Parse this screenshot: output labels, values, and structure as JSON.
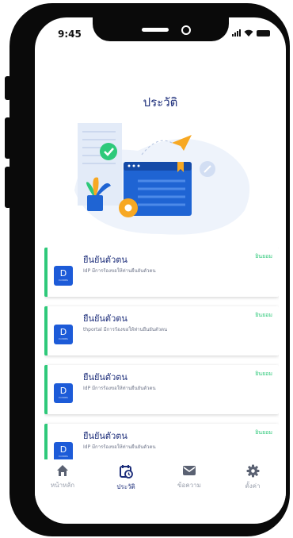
{
  "status_bar": {
    "time": "9:45"
  },
  "page": {
    "title": "ประวัติ"
  },
  "history": {
    "items": [
      {
        "title": "ยืนยันตัวตน",
        "description": "IdP มีการร้องขอให้ท่านยืนยันตัวตน",
        "status": "ยินยอม",
        "logo_letter": "D",
        "logo_sub": "D.DOPA"
      },
      {
        "title": "ยืนยันตัวตน",
        "description": "thportal มีการร้องขอให้ท่านยืนยันตัวตน",
        "status": "ยินยอม",
        "logo_letter": "D",
        "logo_sub": "D.DOPA"
      },
      {
        "title": "ยืนยันตัวตน",
        "description": "IdP มีการร้องขอให้ท่านยืนยันตัวตน",
        "status": "ยินยอม",
        "logo_letter": "D",
        "logo_sub": "D.DOPA"
      },
      {
        "title": "ยืนยันตัวตน",
        "description": "IdP มีการร้องขอให้ท่านยืนยันตัวตน",
        "status": "ยินยอม",
        "logo_letter": "D",
        "logo_sub": "D.DOPA"
      }
    ]
  },
  "tabbar": {
    "tabs": [
      {
        "label": "หน้าหลัก",
        "icon": "home-icon"
      },
      {
        "label": "ประวัติ",
        "icon": "history-icon",
        "active": true
      },
      {
        "label": "ข้อความ",
        "icon": "mail-icon"
      },
      {
        "label": "ตั้งค่า",
        "icon": "gear-icon"
      }
    ]
  },
  "colors": {
    "accent": "#1b2c79",
    "success": "#2ec97a",
    "logo_blue": "#1d5bd8",
    "inactive": "#9aa0ad"
  }
}
